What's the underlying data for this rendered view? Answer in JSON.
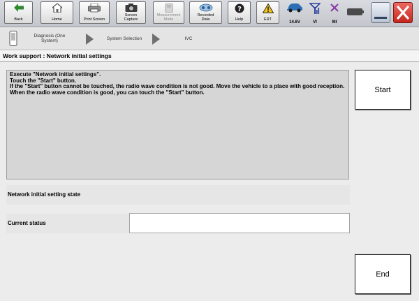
{
  "toolbar": {
    "back": "Back",
    "home": "Home",
    "print_screen": "Print Screen",
    "screen_capture": "Screen\nCapture",
    "measurement_mode": "Measurement\nMode",
    "recorded_data": "Recorded\nData",
    "help": "Help",
    "ert": "ERT",
    "voltage": "14.6V",
    "vi": "VI",
    "mi": "MI"
  },
  "breadcrumb": {
    "item1": "Diagnosis (One\nSystem)",
    "item2": "System Selection",
    "item3": "IVC"
  },
  "page_title": "Work support : Network initial settings",
  "instructions": [
    "Execute \"Network initial settings\".",
    "Touch the \"Start\" button.",
    "If the \"Start\" button cannot be touched, the radio wave condition is not good. Move the vehicle to a place with good reception.",
    "When the radio wave condition is good, you can touch the \"Start\" button."
  ],
  "fields": {
    "network_state_label": "Network initial setting state",
    "network_state_value": "",
    "current_status_label": "Current status",
    "current_status_value": ""
  },
  "buttons": {
    "start": "Start",
    "end": "End"
  },
  "colors": {
    "close_button": "#d0352f",
    "ert_warning": "#f0c419",
    "signal_icon": "#2b3f9e",
    "mi_icon": "#8a3ca8"
  }
}
